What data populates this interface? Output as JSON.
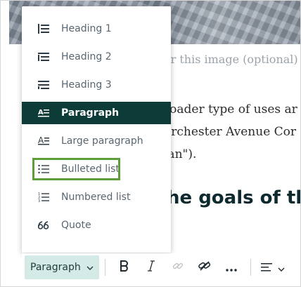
{
  "document": {
    "caption_placeholder": "or this image (optional)",
    "body_lines": [
      "roader type of uses ar",
      "orchester Avenue Cor",
      "lan\")."
    ],
    "heading": "he goals of the"
  },
  "menu": {
    "items": [
      {
        "label": "Heading 1",
        "icon": "heading-1-icon"
      },
      {
        "label": "Heading 2",
        "icon": "heading-2-icon"
      },
      {
        "label": "Heading 3",
        "icon": "heading-3-icon"
      },
      {
        "label": "Paragraph",
        "icon": "paragraph-icon",
        "state": "selected"
      },
      {
        "label": "Large paragraph",
        "icon": "large-paragraph-icon"
      },
      {
        "label": "Bulleted list",
        "icon": "bulleted-list-icon",
        "state": "highlighted"
      },
      {
        "label": "Numbered list",
        "icon": "numbered-list-icon"
      },
      {
        "label": "Quote",
        "icon": "quote-icon"
      }
    ]
  },
  "toolbar": {
    "style_label": "Paragraph",
    "icons": [
      "chevron-down-icon",
      "bold-icon",
      "italic-icon",
      "link-icon",
      "unlink-icon",
      "more-icon",
      "align-left-icon"
    ]
  },
  "colors": {
    "selected_bg": "#0d3b37",
    "highlight_border": "#5b9e3a",
    "dropdown_bg": "#d3eae6"
  }
}
